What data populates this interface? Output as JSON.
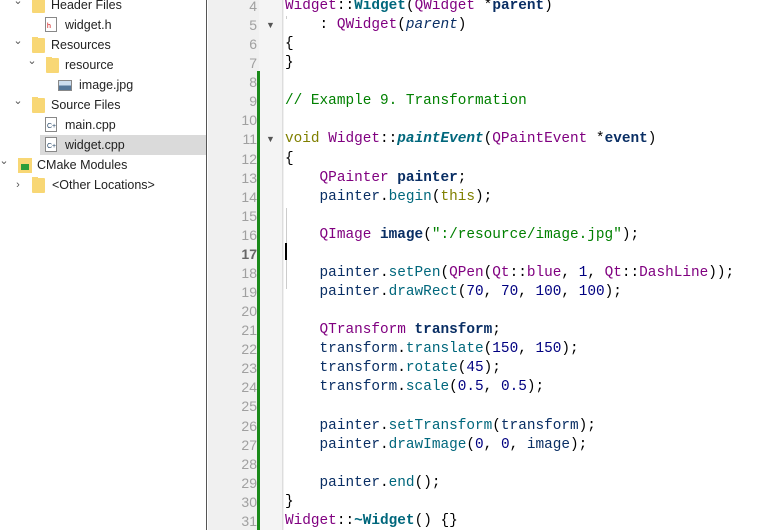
{
  "sidebar": {
    "items": [
      {
        "label": "Header Files",
        "kind": "folder",
        "expanded": true
      },
      {
        "label": "widget.h",
        "kind": "header-file"
      },
      {
        "label": "Resources",
        "kind": "folder",
        "expanded": true
      },
      {
        "label": "resource",
        "kind": "folder",
        "expanded": true
      },
      {
        "label": "image.jpg",
        "kind": "image-file"
      },
      {
        "label": "Source Files",
        "kind": "folder",
        "expanded": true
      },
      {
        "label": "main.cpp",
        "kind": "cpp-file"
      },
      {
        "label": "widget.cpp",
        "kind": "cpp-file",
        "selected": true
      },
      {
        "label": "CMake Modules",
        "kind": "cmake-folder",
        "expanded": true
      },
      {
        "label": "<Other Locations>",
        "kind": "folder",
        "expanded": false
      }
    ]
  },
  "editor": {
    "current_line": 17,
    "lines": [
      {
        "n": "4",
        "fold": false,
        "tokens": [
          [
            "type",
            "Widget"
          ],
          [
            "",
            "::"
          ],
          [
            "fnb",
            "Widget"
          ],
          [
            "",
            "("
          ],
          [
            "type",
            "QWidget"
          ],
          [
            "",
            " *"
          ],
          [
            "varb",
            "parent"
          ],
          [
            "",
            ")"
          ]
        ]
      },
      {
        "n": "5",
        "fold": true,
        "tokens": [
          [
            "",
            "    : "
          ],
          [
            "type",
            "QWidget"
          ],
          [
            "",
            "("
          ],
          [
            "pari",
            "parent"
          ],
          [
            "",
            ")"
          ]
        ]
      },
      {
        "n": "6",
        "fold": false,
        "tokens": [
          [
            "",
            "{"
          ]
        ]
      },
      {
        "n": "7",
        "fold": false,
        "tokens": [
          [
            "",
            "}"
          ]
        ]
      },
      {
        "n": "8",
        "fold": false,
        "tokens": []
      },
      {
        "n": "9",
        "fold": false,
        "tokens": [
          [
            "com",
            "// Example 9. Transformation"
          ]
        ]
      },
      {
        "n": "10",
        "fold": false,
        "tokens": []
      },
      {
        "n": "11",
        "fold": true,
        "tokens": [
          [
            "kw",
            "void"
          ],
          [
            "",
            " "
          ],
          [
            "type",
            "Widget"
          ],
          [
            "",
            "::"
          ],
          [
            "fni",
            "paintEvent"
          ],
          [
            "",
            "("
          ],
          [
            "type",
            "QPaintEvent"
          ],
          [
            "",
            " *"
          ],
          [
            "varb",
            "event"
          ],
          [
            "",
            ")"
          ]
        ]
      },
      {
        "n": "12",
        "fold": false,
        "tokens": [
          [
            "",
            "{"
          ]
        ]
      },
      {
        "n": "13",
        "fold": false,
        "tokens": [
          [
            "",
            "    "
          ],
          [
            "type",
            "QPainter"
          ],
          [
            "",
            " "
          ],
          [
            "varb",
            "painter"
          ],
          [
            "",
            ";"
          ]
        ]
      },
      {
        "n": "14",
        "fold": false,
        "tokens": [
          [
            "",
            "    "
          ],
          [
            "var",
            "painter"
          ],
          [
            "",
            "."
          ],
          [
            "fn",
            "begin"
          ],
          [
            "",
            "("
          ],
          [
            "kw",
            "this"
          ],
          [
            "",
            ");"
          ]
        ]
      },
      {
        "n": "15",
        "fold": false,
        "tokens": []
      },
      {
        "n": "16",
        "fold": false,
        "tokens": [
          [
            "",
            "    "
          ],
          [
            "type",
            "QImage"
          ],
          [
            "",
            " "
          ],
          [
            "varb",
            "image"
          ],
          [
            "",
            "("
          ],
          [
            "str",
            "\":/resource/image.jpg\""
          ],
          [
            "",
            ");"
          ]
        ]
      },
      {
        "n": "17",
        "fold": false,
        "tokens": []
      },
      {
        "n": "18",
        "fold": false,
        "tokens": [
          [
            "",
            "    "
          ],
          [
            "var",
            "painter"
          ],
          [
            "",
            "."
          ],
          [
            "fn",
            "setPen"
          ],
          [
            "",
            "("
          ],
          [
            "type",
            "QPen"
          ],
          [
            "",
            "("
          ],
          [
            "type",
            "Qt"
          ],
          [
            "",
            "::"
          ],
          [
            "enum",
            "blue"
          ],
          [
            "",
            ", "
          ],
          [
            "num",
            "1"
          ],
          [
            "",
            ", "
          ],
          [
            "type",
            "Qt"
          ],
          [
            "",
            "::"
          ],
          [
            "enum",
            "DashLine"
          ],
          [
            "",
            "));"
          ]
        ]
      },
      {
        "n": "19",
        "fold": false,
        "tokens": [
          [
            "",
            "    "
          ],
          [
            "var",
            "painter"
          ],
          [
            "",
            "."
          ],
          [
            "fn",
            "drawRect"
          ],
          [
            "",
            "("
          ],
          [
            "num",
            "70"
          ],
          [
            "",
            ", "
          ],
          [
            "num",
            "70"
          ],
          [
            "",
            ", "
          ],
          [
            "num",
            "100"
          ],
          [
            "",
            ", "
          ],
          [
            "num",
            "100"
          ],
          [
            "",
            ");"
          ]
        ]
      },
      {
        "n": "20",
        "fold": false,
        "tokens": []
      },
      {
        "n": "21",
        "fold": false,
        "tokens": [
          [
            "",
            "    "
          ],
          [
            "type",
            "QTransform"
          ],
          [
            "",
            " "
          ],
          [
            "varb",
            "transform"
          ],
          [
            "",
            ";"
          ]
        ]
      },
      {
        "n": "22",
        "fold": false,
        "tokens": [
          [
            "",
            "    "
          ],
          [
            "var",
            "transform"
          ],
          [
            "",
            "."
          ],
          [
            "fn",
            "translate"
          ],
          [
            "",
            "("
          ],
          [
            "num",
            "150"
          ],
          [
            "",
            ", "
          ],
          [
            "num",
            "150"
          ],
          [
            "",
            ");"
          ]
        ]
      },
      {
        "n": "23",
        "fold": false,
        "tokens": [
          [
            "",
            "    "
          ],
          [
            "var",
            "transform"
          ],
          [
            "",
            "."
          ],
          [
            "fn",
            "rotate"
          ],
          [
            "",
            "("
          ],
          [
            "num",
            "45"
          ],
          [
            "",
            ");"
          ]
        ]
      },
      {
        "n": "24",
        "fold": false,
        "tokens": [
          [
            "",
            "    "
          ],
          [
            "var",
            "transform"
          ],
          [
            "",
            "."
          ],
          [
            "fn",
            "scale"
          ],
          [
            "",
            "("
          ],
          [
            "num",
            "0.5"
          ],
          [
            "",
            ", "
          ],
          [
            "num",
            "0.5"
          ],
          [
            "",
            ");"
          ]
        ]
      },
      {
        "n": "25",
        "fold": false,
        "tokens": []
      },
      {
        "n": "26",
        "fold": false,
        "tokens": [
          [
            "",
            "    "
          ],
          [
            "var",
            "painter"
          ],
          [
            "",
            "."
          ],
          [
            "fn",
            "setTransform"
          ],
          [
            "",
            "("
          ],
          [
            "var",
            "transform"
          ],
          [
            "",
            ");"
          ]
        ]
      },
      {
        "n": "27",
        "fold": false,
        "tokens": [
          [
            "",
            "    "
          ],
          [
            "var",
            "painter"
          ],
          [
            "",
            "."
          ],
          [
            "fn",
            "drawImage"
          ],
          [
            "",
            "("
          ],
          [
            "num",
            "0"
          ],
          [
            "",
            ", "
          ],
          [
            "num",
            "0"
          ],
          [
            "",
            ", "
          ],
          [
            "var",
            "image"
          ],
          [
            "",
            ");"
          ]
        ]
      },
      {
        "n": "28",
        "fold": false,
        "tokens": []
      },
      {
        "n": "29",
        "fold": false,
        "tokens": [
          [
            "",
            "    "
          ],
          [
            "var",
            "painter"
          ],
          [
            "",
            "."
          ],
          [
            "fn",
            "end"
          ],
          [
            "",
            "();"
          ]
        ]
      },
      {
        "n": "30",
        "fold": false,
        "tokens": [
          [
            "",
            "}"
          ]
        ]
      },
      {
        "n": "31",
        "fold": false,
        "tokens": [
          [
            "type",
            "Widget"
          ],
          [
            "",
            "::"
          ],
          [
            "fnb",
            "~Widget"
          ],
          [
            "",
            "() {}"
          ]
        ]
      }
    ]
  }
}
